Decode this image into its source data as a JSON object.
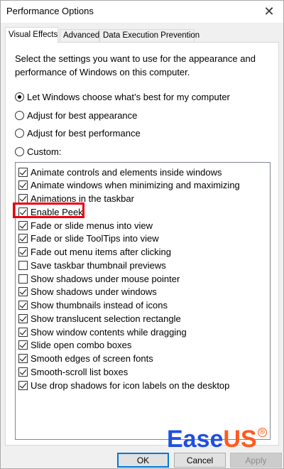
{
  "window": {
    "title": "Performance Options",
    "close_glyph": "✕"
  },
  "tabs": [
    {
      "label": "Visual Effects",
      "active": true
    },
    {
      "label": "Advanced",
      "active": false
    },
    {
      "label": "Data Execution Prevention",
      "active": false
    }
  ],
  "description": "Select the settings you want to use for the appearance and performance of Windows on this computer.",
  "radios": [
    {
      "label": "Let Windows choose what’s best for my computer",
      "checked": true
    },
    {
      "label": "Adjust for best appearance",
      "checked": false
    },
    {
      "label": "Adjust for best performance",
      "checked": false
    },
    {
      "label": "Custom:",
      "checked": false
    }
  ],
  "effects": [
    {
      "label": "Animate controls and elements inside windows",
      "checked": true
    },
    {
      "label": "Animate windows when minimizing and maximizing",
      "checked": true
    },
    {
      "label": "Animations in the taskbar",
      "checked": true
    },
    {
      "label": "Enable Peek",
      "checked": true,
      "highlighted": true
    },
    {
      "label": "Fade or slide menus into view",
      "checked": true
    },
    {
      "label": "Fade or slide ToolTips into view",
      "checked": true
    },
    {
      "label": "Fade out menu items after clicking",
      "checked": true
    },
    {
      "label": "Save taskbar thumbnail previews",
      "checked": false
    },
    {
      "label": "Show shadows under mouse pointer",
      "checked": false
    },
    {
      "label": "Show shadows under windows",
      "checked": true
    },
    {
      "label": "Show thumbnails instead of icons",
      "checked": true
    },
    {
      "label": "Show translucent selection rectangle",
      "checked": true
    },
    {
      "label": "Show window contents while dragging",
      "checked": true
    },
    {
      "label": "Slide open combo boxes",
      "checked": true
    },
    {
      "label": "Smooth edges of screen fonts",
      "checked": true
    },
    {
      "label": "Smooth-scroll list boxes",
      "checked": true
    },
    {
      "label": "Use drop shadows for icon labels on the desktop",
      "checked": true
    }
  ],
  "buttons": {
    "ok": "OK",
    "cancel": "Cancel",
    "apply": "Apply"
  },
  "watermark": {
    "part1": "Ease",
    "part2": "US",
    "reg": "®"
  },
  "colors": {
    "highlight_border": "#e8000b",
    "watermark_blue": "#1f4fe0",
    "watermark_orange": "#ff5a1f"
  }
}
